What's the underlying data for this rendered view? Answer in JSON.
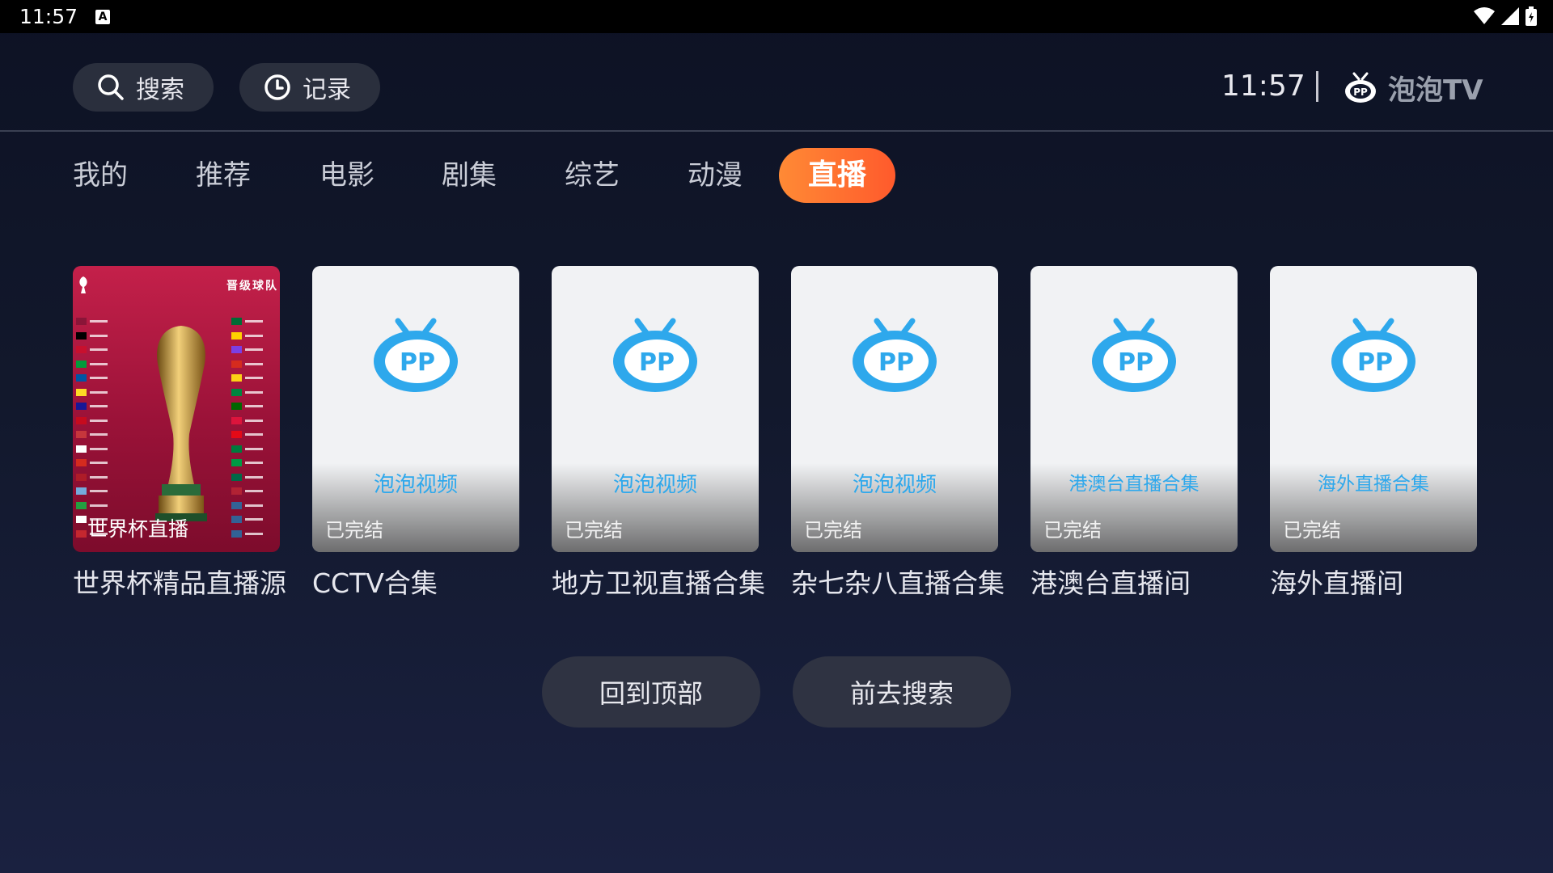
{
  "status_bar": {
    "time": "11:57",
    "notification_badge": "A"
  },
  "header": {
    "search_label": "搜索",
    "history_label": "记录",
    "clock": "11:57",
    "brand_name": "泡泡TV"
  },
  "tabs": [
    {
      "label": "我的"
    },
    {
      "label": "推荐"
    },
    {
      "label": "电影"
    },
    {
      "label": "剧集"
    },
    {
      "label": "综艺"
    },
    {
      "label": "动漫"
    },
    {
      "label": "直播",
      "active": true
    }
  ],
  "cards": [
    {
      "title": "世界杯精品直播源",
      "poster_label": "世界杯直播",
      "poster_heading": "晋级球队"
    },
    {
      "title": "CCTV合集",
      "subtitle": "泡泡视频",
      "status": "已完结"
    },
    {
      "title": "地方卫视直播合集",
      "subtitle": "泡泡视频",
      "status": "已完结"
    },
    {
      "title": "杂七杂八直播合集",
      "subtitle": "泡泡视频",
      "status": "已完结"
    },
    {
      "title": "港澳台直播间",
      "subtitle": "港澳台直播合集",
      "status": "已完结"
    },
    {
      "title": "海外直播间",
      "subtitle": "海外直播合集",
      "status": "已完结"
    }
  ],
  "actions": {
    "back_to_top": "回到顶部",
    "go_search": "前去搜索"
  },
  "colors": {
    "accent": "#ff6a30",
    "brand_blue": "#2ea8ec",
    "background": "#12182c"
  }
}
